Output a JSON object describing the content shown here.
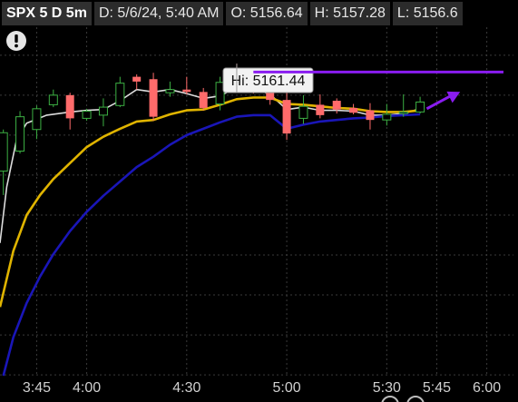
{
  "header": {
    "symbol": "SPX 5 D 5m",
    "date": "D: 5/6/24, 5:40 AM",
    "open": "O: 5156.64",
    "high": "H: 5157.28",
    "low": "L: 5156.6"
  },
  "tooltip": {
    "label": "Hi: 5161.44"
  },
  "colors": {
    "background": "#000000",
    "grid": "#3a3a3a",
    "bull": "#3cb043",
    "bear": "#ff6b6b",
    "ema_white": "#dcdcdc",
    "ema_yellow": "#e0b400",
    "ema_blue": "#1a16b8",
    "annotation": "#8a1cf0"
  },
  "icons": {
    "alert": "exclamation-circle-icon"
  },
  "chart_data": {
    "type": "candlestick",
    "x_ticks": [
      {
        "label": "3:45",
        "t": 225
      },
      {
        "label": "4:00",
        "t": 240
      },
      {
        "label": "4:30",
        "t": 270
      },
      {
        "label": "5:00",
        "t": 300
      },
      {
        "label": "5:30",
        "t": 330
      },
      {
        "label": "5:45",
        "t": 345
      },
      {
        "label": "6:00",
        "t": 360
      }
    ],
    "x_range": [
      214,
      368
    ],
    "y_range": [
      5122.4,
      5166.0
    ],
    "gridlines_y": [
      5162.5,
      5157.5,
      5152.5,
      5147.5,
      5142.5,
      5137.5,
      5132.5,
      5127.5,
      5122.5
    ],
    "candles": [
      {
        "t": 215,
        "o": 5148.0,
        "h": 5153.2,
        "l": 5145.0,
        "c": 5152.8
      },
      {
        "t": 220,
        "o": 5150.5,
        "h": 5155.5,
        "l": 5150.2,
        "c": 5154.8
      },
      {
        "t": 225,
        "o": 5153.2,
        "h": 5156.2,
        "l": 5152.0,
        "c": 5155.8
      },
      {
        "t": 230,
        "o": 5156.3,
        "h": 5158.2,
        "l": 5156.0,
        "c": 5157.5
      },
      {
        "t": 235,
        "o": 5157.5,
        "h": 5157.8,
        "l": 5153.2,
        "c": 5154.6
      },
      {
        "t": 240,
        "o": 5154.6,
        "h": 5155.8,
        "l": 5154.3,
        "c": 5155.5
      },
      {
        "t": 245,
        "o": 5155.0,
        "h": 5157.1,
        "l": 5153.6,
        "c": 5156.0
      },
      {
        "t": 250,
        "o": 5156.2,
        "h": 5159.8,
        "l": 5156.0,
        "c": 5159.0
      },
      {
        "t": 255,
        "o": 5159.8,
        "h": 5160.1,
        "l": 5158.2,
        "c": 5159.2
      },
      {
        "t": 260,
        "o": 5159.5,
        "h": 5160.3,
        "l": 5154.3,
        "c": 5154.8
      },
      {
        "t": 265,
        "o": 5157.8,
        "h": 5159.2,
        "l": 5157.3,
        "c": 5158.2
      },
      {
        "t": 270,
        "o": 5158.2,
        "h": 5159.8,
        "l": 5157.6,
        "c": 5157.9
      },
      {
        "t": 275,
        "o": 5157.9,
        "h": 5158.4,
        "l": 5155.6,
        "c": 5155.9
      },
      {
        "t": 280,
        "o": 5156.4,
        "h": 5159.8,
        "l": 5155.6,
        "c": 5159.1
      },
      {
        "t": 285,
        "o": 5159.4,
        "h": 5161.44,
        "l": 5157.8,
        "c": 5158.7
      },
      {
        "t": 290,
        "o": 5158.7,
        "h": 5158.9,
        "l": 5157.7,
        "c": 5158.1
      },
      {
        "t": 295,
        "o": 5158.1,
        "h": 5158.4,
        "l": 5156.3,
        "c": 5156.9
      },
      {
        "t": 300,
        "o": 5156.9,
        "h": 5157.9,
        "l": 5151.9,
        "c": 5152.7
      },
      {
        "t": 305,
        "o": 5154.6,
        "h": 5157.5,
        "l": 5153.9,
        "c": 5156.1
      },
      {
        "t": 310,
        "o": 5156.3,
        "h": 5157.6,
        "l": 5154.6,
        "c": 5155.0
      },
      {
        "t": 315,
        "o": 5156.8,
        "h": 5157.1,
        "l": 5155.2,
        "c": 5155.7
      },
      {
        "t": 320,
        "o": 5155.9,
        "h": 5156.4,
        "l": 5155.1,
        "c": 5155.3
      },
      {
        "t": 325,
        "o": 5155.6,
        "h": 5156.5,
        "l": 5153.2,
        "c": 5154.4
      },
      {
        "t": 330,
        "o": 5154.4,
        "h": 5156.4,
        "l": 5153.7,
        "c": 5155.1
      },
      {
        "t": 335,
        "o": 5155.2,
        "h": 5157.6,
        "l": 5154.8,
        "c": 5155.4
      },
      {
        "t": 340,
        "o": 5155.4,
        "h": 5157.3,
        "l": 5155.2,
        "c": 5156.64
      }
    ],
    "series": [
      {
        "style": "ema_white",
        "points": [
          [
            214,
            5139.0
          ],
          [
            216,
            5146.0
          ],
          [
            219,
            5152.0
          ],
          [
            222,
            5154.0
          ],
          [
            228,
            5155.0
          ],
          [
            235,
            5155.4
          ],
          [
            240,
            5155.6
          ],
          [
            245,
            5155.7
          ],
          [
            250,
            5156.8
          ],
          [
            255,
            5158.2
          ],
          [
            260,
            5157.9
          ],
          [
            265,
            5158.2
          ],
          [
            270,
            5157.7
          ],
          [
            275,
            5157.1
          ],
          [
            280,
            5157.4
          ],
          [
            285,
            5158.5
          ],
          [
            290,
            5158.4
          ],
          [
            295,
            5157.6
          ],
          [
            300,
            5155.7
          ],
          [
            305,
            5156.0
          ],
          [
            310,
            5155.6
          ],
          [
            315,
            5155.6
          ],
          [
            320,
            5155.5
          ],
          [
            325,
            5155.0
          ],
          [
            330,
            5155.0
          ],
          [
            335,
            5155.2
          ],
          [
            340,
            5155.8
          ]
        ]
      },
      {
        "style": "ema_yellow",
        "points": [
          [
            214,
            5131.0
          ],
          [
            218,
            5138.0
          ],
          [
            222,
            5142.5
          ],
          [
            226,
            5145.0
          ],
          [
            230,
            5147.0
          ],
          [
            235,
            5149.0
          ],
          [
            240,
            5151.0
          ],
          [
            245,
            5152.3
          ],
          [
            250,
            5153.3
          ],
          [
            255,
            5154.2
          ],
          [
            260,
            5154.4
          ],
          [
            265,
            5155.1
          ],
          [
            270,
            5155.6
          ],
          [
            275,
            5155.7
          ],
          [
            280,
            5156.3
          ],
          [
            285,
            5157.0
          ],
          [
            290,
            5157.2
          ],
          [
            295,
            5157.2
          ],
          [
            300,
            5156.4
          ],
          [
            305,
            5156.3
          ],
          [
            310,
            5156.1
          ],
          [
            315,
            5155.9
          ],
          [
            320,
            5155.8
          ],
          [
            325,
            5155.5
          ],
          [
            330,
            5155.4
          ],
          [
            335,
            5155.4
          ],
          [
            340,
            5155.6
          ]
        ]
      },
      {
        "style": "ema_blue",
        "points": [
          [
            215,
            5122.4
          ],
          [
            218,
            5127.2
          ],
          [
            222,
            5131.5
          ],
          [
            226,
            5134.8
          ],
          [
            230,
            5137.6
          ],
          [
            235,
            5140.5
          ],
          [
            240,
            5142.9
          ],
          [
            245,
            5144.9
          ],
          [
            250,
            5146.7
          ],
          [
            255,
            5148.5
          ],
          [
            260,
            5149.8
          ],
          [
            265,
            5151.3
          ],
          [
            270,
            5152.5
          ],
          [
            275,
            5153.3
          ],
          [
            280,
            5154.1
          ],
          [
            285,
            5154.8
          ],
          [
            290,
            5155.0
          ],
          [
            295,
            5155.0
          ],
          [
            300,
            5153.3
          ],
          [
            305,
            5153.8
          ],
          [
            310,
            5154.2
          ],
          [
            315,
            5154.4
          ],
          [
            320,
            5154.6
          ],
          [
            325,
            5154.7
          ],
          [
            330,
            5154.9
          ],
          [
            335,
            5155.0
          ],
          [
            340,
            5155.1
          ]
        ]
      }
    ],
    "annotations": {
      "high_label": "Hi: 5161.44",
      "horizontal_line": {
        "t1": 290,
        "t2": 365,
        "y": 5160.4
      },
      "trend_arrow": {
        "t1": 342,
        "y1": 5155.8,
        "t2": 352,
        "y2": 5157.9
      }
    }
  }
}
